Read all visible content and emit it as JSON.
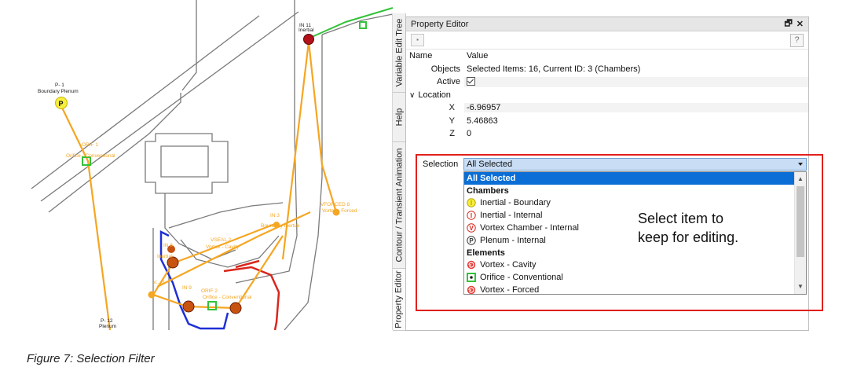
{
  "canvas_labels": {
    "p1_id": "P- 1",
    "p1_name": "Boundary Plenum",
    "p1_badge": "P",
    "orif1_id": "ORIF 1",
    "orif1_name": "Orifice - Conventional",
    "in11_id": "IN 11",
    "in11_name": "Inertial",
    "in3_id": "IN 3",
    "in3_name": "Boundary Inertial",
    "vforced_id": "VFORCED 8",
    "vforced_name": "Vortex - Forced",
    "vseal_id": "VSEAL 2",
    "vseal_name": "Vortex - Cavity",
    "in8_id": "IN 8",
    "in8_name": "Inertial",
    "v3_id": "V... 3",
    "in9_id": "IN 9",
    "orif2_id": "ORIF 2",
    "orif2_name": "Orifice - Conventional",
    "p12_id": "P- 12",
    "p12_name": "Plenum"
  },
  "dock_tabs": [
    "Variable Edit Tree",
    "Help",
    "Contour / Transient Animation",
    "Property Editor"
  ],
  "panel": {
    "title": "Property Editor",
    "pin_glyph": "🗗",
    "close_glyph": "✕",
    "help_glyph": "?",
    "toolbar_glyph": "▪",
    "header_name": "Name",
    "header_value": "Value",
    "rows": [
      {
        "name": "Objects",
        "value": "Selected Items: 16, Current ID: 3 (Chambers)"
      },
      {
        "name": "Active",
        "value": ""
      },
      {
        "name": "Location",
        "value": ""
      },
      {
        "name": "X",
        "value": "-6.96957"
      },
      {
        "name": "Y",
        "value": "5.46863"
      },
      {
        "name": "Z",
        "value": "0"
      }
    ],
    "expander_glyph": "∨",
    "selection_label": "Selection",
    "selection_value": "All Selected"
  },
  "dropdown": {
    "options": [
      {
        "label": "All Selected",
        "kind": "selected",
        "icon": ""
      },
      {
        "label": "Chambers",
        "kind": "header",
        "icon": ""
      },
      {
        "label": "Inertial - Boundary",
        "kind": "item",
        "icon": "boundary-inertial-icon"
      },
      {
        "label": "Inertial - Internal",
        "kind": "item",
        "icon": "internal-inertial-icon"
      },
      {
        "label": "Vortex Chamber - Internal",
        "kind": "item",
        "icon": "vortex-chamber-icon"
      },
      {
        "label": "Plenum - Internal",
        "kind": "item",
        "icon": "plenum-icon"
      },
      {
        "label": "Elements",
        "kind": "header",
        "icon": ""
      },
      {
        "label": "Vortex - Cavity",
        "kind": "item",
        "icon": "vortex-cavity-icon"
      },
      {
        "label": "Orifice - Conventional",
        "kind": "item",
        "icon": "orifice-icon"
      },
      {
        "label": "Vortex - Forced",
        "kind": "item",
        "icon": "vortex-forced-icon"
      }
    ],
    "icon_letters": {
      "boundary-inertial-icon": "I",
      "internal-inertial-icon": "I",
      "vortex-chamber-icon": "V",
      "plenum-icon": "P"
    }
  },
  "annotation": "Select item to\nkeep for editing.",
  "caption": "Figure 7: Selection Filter",
  "colors": {
    "flow_line": "#f5a623",
    "plenum_yellow": "#f6ee3c",
    "wall_red": "#d9261c",
    "wall_blue": "#1f2fd6",
    "orifice_green": "#34c23a",
    "highlight": "#e0201c",
    "selected_row": "#0a6ed6"
  }
}
